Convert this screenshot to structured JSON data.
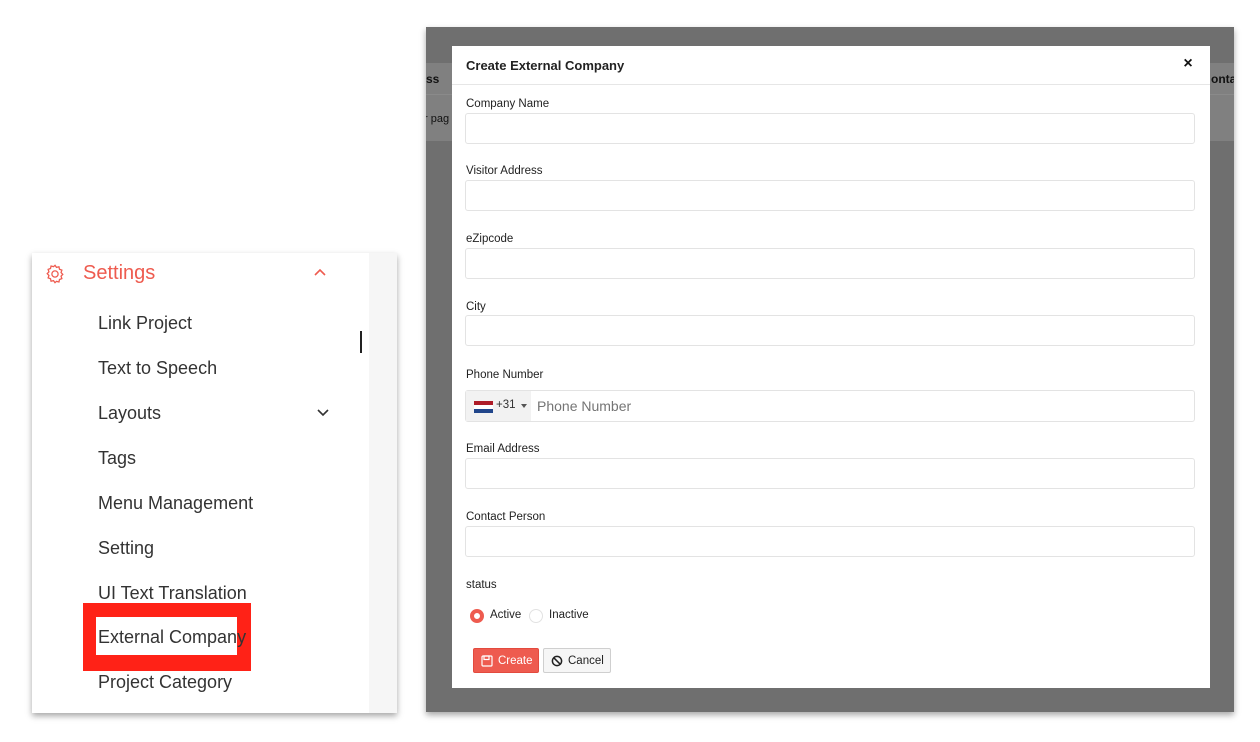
{
  "sidebar": {
    "section_title": "Settings",
    "section_icon": "gear-icon",
    "accent_color": "#ee5b4f",
    "items": [
      {
        "label": "Link Project"
      },
      {
        "label": "Text to Speech"
      },
      {
        "label": "Layouts",
        "has_submenu": true
      },
      {
        "label": "Tags"
      },
      {
        "label": "Menu Management"
      },
      {
        "label": "Setting"
      },
      {
        "label": "UI Text Translation"
      },
      {
        "label": "External Company",
        "highlighted": true
      },
      {
        "label": "Project Category"
      }
    ],
    "highlight_color": "#ff2217"
  },
  "background": {
    "left_header_fragment": "ss",
    "left_row_fragment": "r pag",
    "right_header_fragment": "onta"
  },
  "modal": {
    "title": "Create External Company",
    "close_glyph": "×",
    "fields": {
      "company_name": {
        "label": "Company Name",
        "value": ""
      },
      "visitor_address": {
        "label": "Visitor Address",
        "value": ""
      },
      "zipcode": {
        "label": "eZipcode",
        "value": ""
      },
      "city": {
        "label": "City",
        "value": ""
      },
      "phone": {
        "label": "Phone Number",
        "country_code": "+31",
        "country": "Netherlands",
        "placeholder": "Phone Number",
        "value": ""
      },
      "email": {
        "label": "Email Address",
        "value": ""
      },
      "contact_person": {
        "label": "Contact Person",
        "value": ""
      }
    },
    "status": {
      "label": "status",
      "options": [
        "Active",
        "Inactive"
      ],
      "selected": "Active"
    },
    "buttons": {
      "create_label": "Create",
      "cancel_label": "Cancel",
      "create_color": "#ee5b4f"
    }
  }
}
